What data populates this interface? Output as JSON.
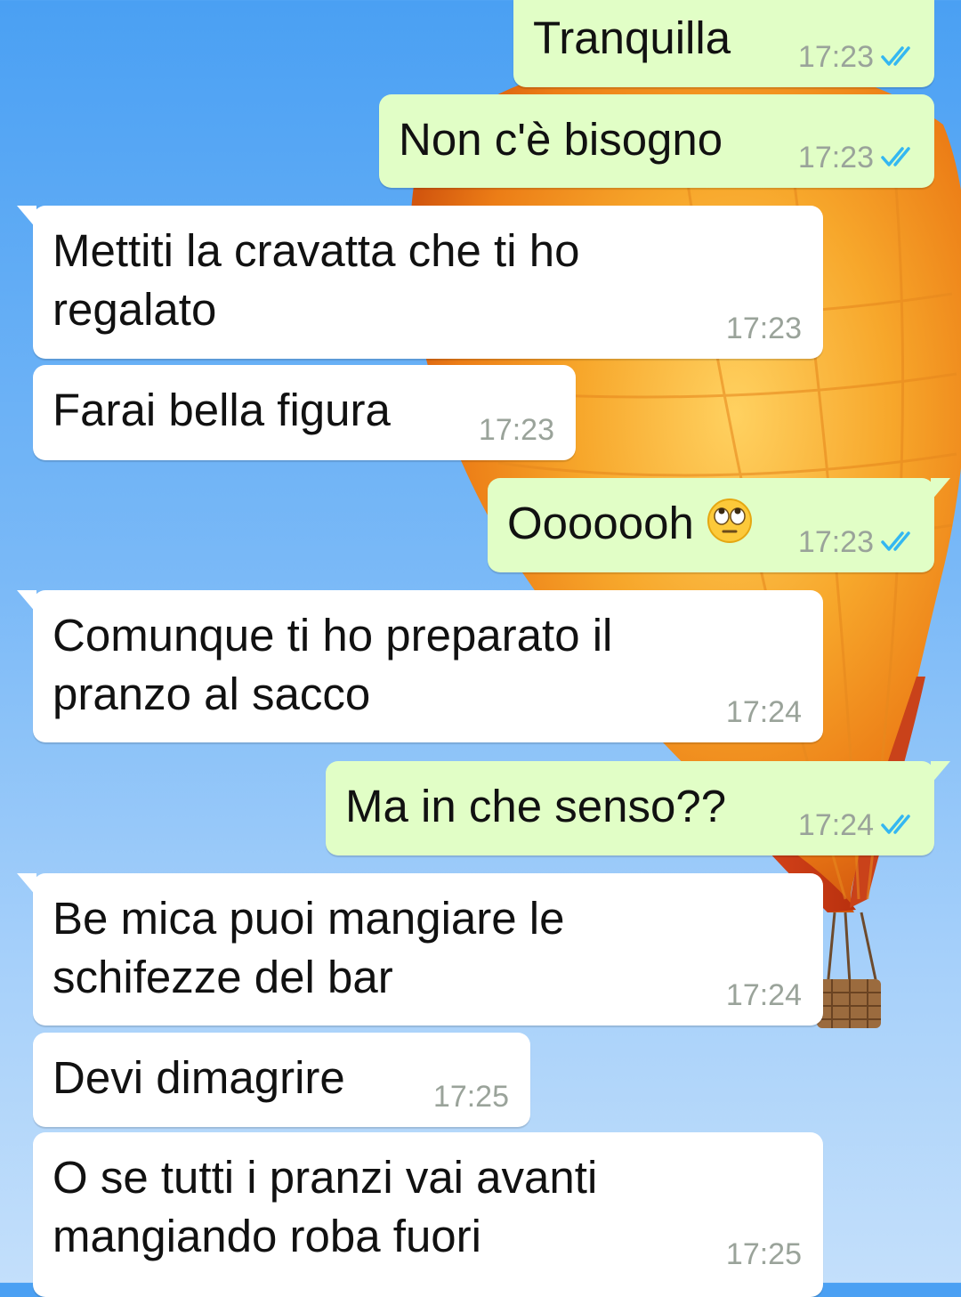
{
  "colors": {
    "incoming_bubble": "#ffffff",
    "outgoing_bubble": "#e1fec6",
    "read_ticks": "#34b7f1",
    "timestamp": "#9aa39a"
  },
  "messages": [
    {
      "direction": "out",
      "text": "Tranquilla",
      "time": "17:23",
      "status": "read-double-check-icon"
    },
    {
      "direction": "out",
      "text": "Non c'è bisogno",
      "time": "17:23",
      "status": "read-double-check-icon"
    },
    {
      "direction": "in",
      "text": "Mettiti la cravatta che ti ho\nregalato",
      "time": "17:23"
    },
    {
      "direction": "in",
      "text": "Farai bella figura",
      "time": "17:23"
    },
    {
      "direction": "out",
      "text": "Ooooooh",
      "emoji": "face-with-rolling-eyes-emoji",
      "time": "17:23",
      "status": "read-double-check-icon"
    },
    {
      "direction": "in",
      "text": "Comunque ti ho preparato il\npranzo al sacco",
      "time": "17:24"
    },
    {
      "direction": "out",
      "text": "Ma in che senso??",
      "time": "17:24",
      "status": "read-double-check-icon"
    },
    {
      "direction": "in",
      "text": "Be mica puoi mangiare le\nschifezze del bar",
      "time": "17:24"
    },
    {
      "direction": "in",
      "text": "Devi dimagrire",
      "time": "17:25"
    },
    {
      "direction": "in",
      "text": "O se tutti i pranzi vai avanti\nmangiando roba fuori",
      "time": "17:25"
    }
  ]
}
